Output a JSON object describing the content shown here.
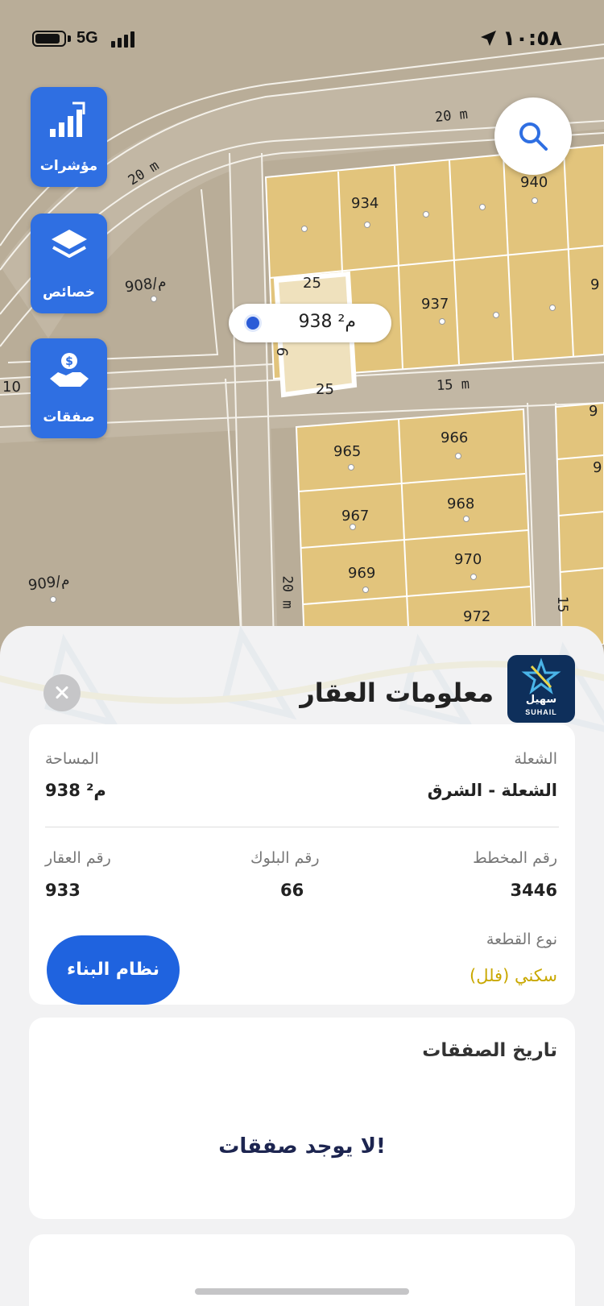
{
  "status_bar": {
    "network": "5G",
    "time": "١٠:٥٨"
  },
  "side_buttons": [
    {
      "id": "indicators",
      "label": "مؤشرات",
      "icon": "bar-chart-icon"
    },
    {
      "id": "properties",
      "label": "خصائص",
      "icon": "layers-icon"
    },
    {
      "id": "deals",
      "label": "صفقات",
      "icon": "handshake-dollar-icon"
    }
  ],
  "map": {
    "plots": [
      "934",
      "940",
      "937",
      "965",
      "966",
      "967",
      "968",
      "969",
      "970",
      "972",
      "9",
      "9",
      "9"
    ],
    "roads": [
      "20 m",
      "20 m",
      "15 m",
      "20 m",
      "15"
    ],
    "side_labels": [
      "908/م",
      "909/م",
      "10"
    ],
    "selected_dims": [
      "25",
      "25",
      "6"
    ],
    "callout": "938 م²"
  },
  "sheet": {
    "title": "معلومات العقار",
    "logo_ar": "سهيل",
    "logo_en": "SUHAIL",
    "details": {
      "district_label": "الشعلة",
      "district_value": "الشعلة - الشرق",
      "area_label": "المساحة",
      "area_value": "938 م²",
      "plan_label": "رقم المخطط",
      "plan_value": "3446",
      "block_label": "رقم البلوك",
      "block_value": "66",
      "property_label": "رقم العقار",
      "property_value": "933",
      "type_label": "نوع القطعة",
      "type_value": "سكني (فلل)",
      "build_button": "نظام البناء"
    },
    "history": {
      "title": "تاريخ الصفقات",
      "empty": "لا يوجد صفقات!"
    }
  },
  "colors": {
    "accent": "#2f6fe2",
    "plot_fill": "#e0c57e",
    "gold_text": "#c9a800",
    "logo_bg": "#0e2f5b"
  }
}
